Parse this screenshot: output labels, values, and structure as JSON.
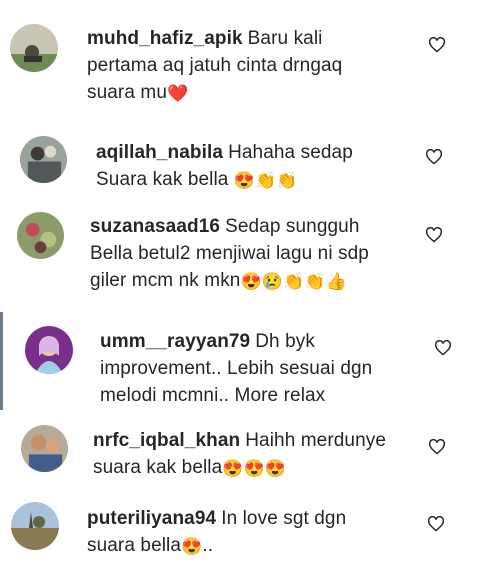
{
  "comments": [
    {
      "username": "muhd_hafiz_apik",
      "text": "Baru kali pertama aq jatuh cinta drngaq suara mu",
      "emojis": "❤️"
    },
    {
      "username": "aqillah_nabila",
      "text": "Hahaha sedap Suara kak bella",
      "emojis": "😍👏👏"
    },
    {
      "username": "suzanasaad16",
      "text": "Sedap sungguh Bella betul2 menjiwai lagu ni sdp giler mcm nk mkn",
      "emojis": "😍😢👏👏👍"
    },
    {
      "username": "umm__rayyan79",
      "text": "Dh byk improvement.. Lebih sesuai dgn melodi mcmni.. More relax",
      "emojis": ""
    },
    {
      "username": "nrfc_iqbal_khan",
      "text": "Haihh merdunye suara kak bella",
      "emojis": "😍😍😍"
    },
    {
      "username": "puteriliyana94",
      "text": "In love sgt dgn suara bella",
      "emojis": "😍",
      "trailing": ".."
    }
  ],
  "icons": {
    "like": "heart-outline-icon"
  }
}
